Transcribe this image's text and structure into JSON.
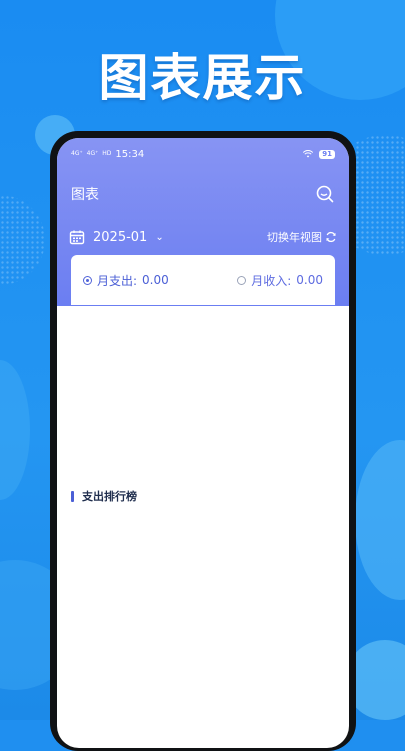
{
  "promo": {
    "headline": "图表展示"
  },
  "status_bar": {
    "left_signal_1": "4G⁺",
    "left_signal_2": "4G⁺",
    "hd": "HD",
    "time": "15:34",
    "battery": "91"
  },
  "app": {
    "title": "图表",
    "date_selector": {
      "value": "2025-01"
    },
    "switch_view": {
      "label": "切换年视图"
    },
    "summary": {
      "expense_label": "月支出:",
      "expense_value": "0.00",
      "income_label": "月收入:",
      "income_value": "0.00"
    },
    "ranking": {
      "title": "支出排行榜"
    }
  },
  "colors": {
    "primary": "#6b7ef2",
    "accent": "#4b5fd6",
    "background": "#1f8ff0"
  },
  "icons": [
    "search-icon",
    "calendar-icon",
    "chevron-down-icon",
    "refresh-icon",
    "wifi-icon",
    "battery-icon"
  ]
}
